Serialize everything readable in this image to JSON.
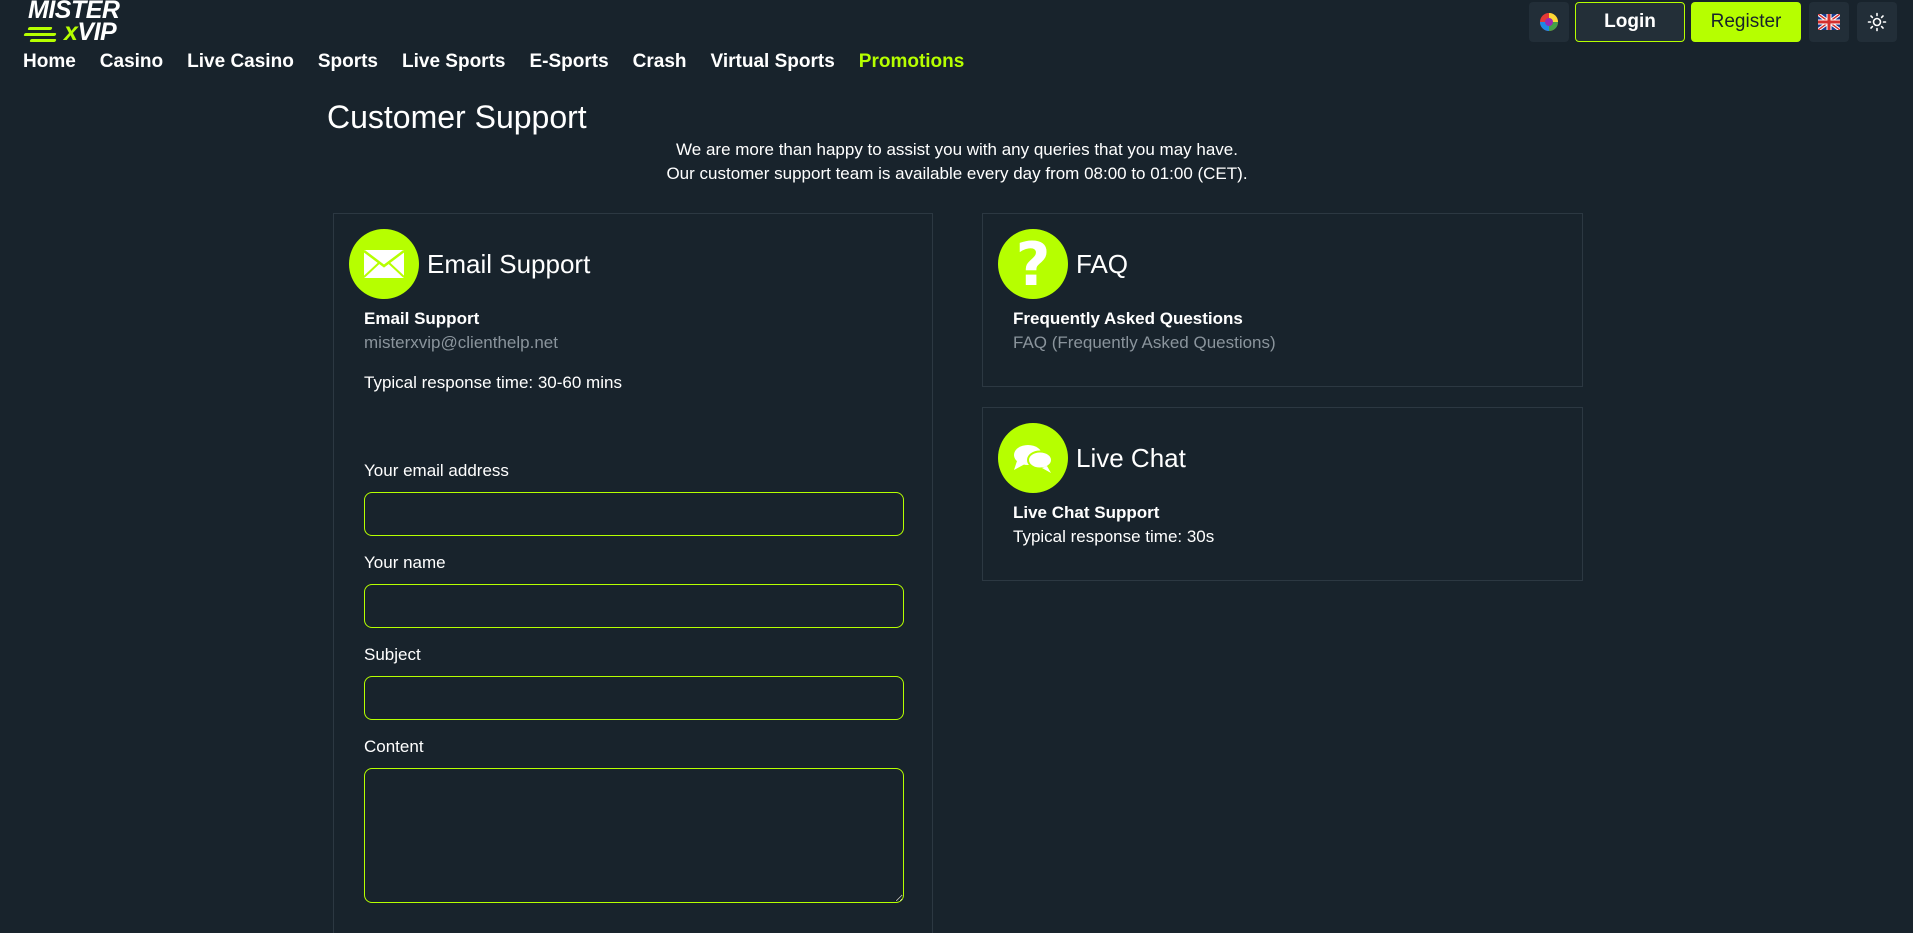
{
  "brand": {
    "line1": "MISTER",
    "line2_x": "x",
    "line2_rest": "VIP"
  },
  "nav": [
    {
      "label": "Home"
    },
    {
      "label": "Casino"
    },
    {
      "label": "Live Casino"
    },
    {
      "label": "Sports"
    },
    {
      "label": "Live Sports"
    },
    {
      "label": "E-Sports"
    },
    {
      "label": "Crash"
    },
    {
      "label": "Virtual Sports"
    },
    {
      "label": "Promotions",
      "active": true
    }
  ],
  "header": {
    "login_label": "Login",
    "register_label": "Register"
  },
  "icons": {
    "color_wheel": "color-wheel-icon",
    "flag": "uk-flag-icon",
    "theme": "sun-icon"
  },
  "colors": {
    "accent": "#b6ff00",
    "background": "#18232c",
    "muted": "#8a949c"
  },
  "page": {
    "title": "Customer Support",
    "intro_line1": "We are more than happy to assist you with any queries that you may have.",
    "intro_line2": "Our customer support team is available every day from 08:00 to 01:00 (CET)."
  },
  "email_card": {
    "title": "Email Support",
    "subtitle": "Email Support",
    "email": "misterxvip@clienthelp.net",
    "response_time": "Typical response time: 30-60 mins",
    "fields": {
      "email_label": "Your email address",
      "name_label": "Your name",
      "subject_label": "Subject",
      "content_label": "Content"
    }
  },
  "faq_card": {
    "title": "FAQ",
    "subtitle": "Frequently Asked Questions",
    "link": "FAQ (Frequently Asked Questions)"
  },
  "chat_card": {
    "title": "Live Chat",
    "subtitle": "Live Chat Support",
    "response_time": "Typical response time: 30s"
  }
}
